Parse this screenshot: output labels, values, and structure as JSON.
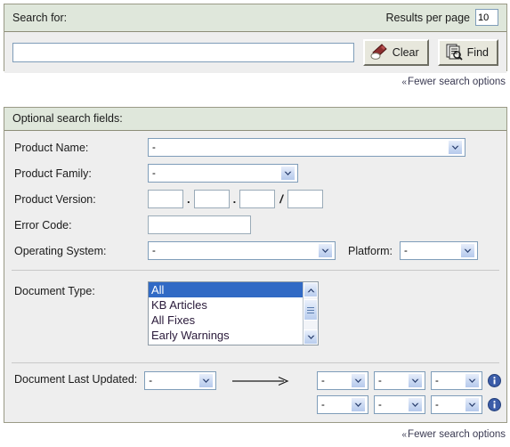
{
  "search_panel": {
    "title": "Search for:",
    "results_per_page_label": "Results per page",
    "results_per_page_value": "10",
    "query_value": "",
    "query_placeholder": "",
    "clear_button": "Clear",
    "find_button": "Find"
  },
  "fewer_link_top": {
    "chevron": "«",
    "label": "Fewer search options"
  },
  "fewer_link_bottom": {
    "chevron": "«",
    "label": "Fewer search options"
  },
  "optional_panel": {
    "title": "Optional search fields:",
    "fields": {
      "product_name": {
        "label": "Product Name:",
        "value": "-"
      },
      "product_family": {
        "label": "Product Family:",
        "value": "-"
      },
      "product_version": {
        "label": "Product Version:",
        "v1": "",
        "v2": "",
        "v3": "",
        "v4": "",
        "sep1": ".",
        "sep2": ".",
        "sep3": "/"
      },
      "error_code": {
        "label": "Error Code:",
        "value": ""
      },
      "operating_system": {
        "label": "Operating System:",
        "value": "-"
      },
      "platform": {
        "label": "Platform:",
        "value": "-"
      },
      "document_type": {
        "label": "Document Type:",
        "options": [
          "All",
          "KB Articles",
          "All Fixes",
          "Early Warnings"
        ],
        "selected": "All"
      },
      "document_last_updated": {
        "label": "Document Last Updated:",
        "from_value": "-",
        "arrow": "→",
        "row1": [
          "-",
          "-",
          "-"
        ],
        "row2": [
          "-",
          "-",
          "-"
        ],
        "info_tooltip": "i"
      }
    }
  },
  "colors": {
    "header_green": "#dfe7db",
    "panel_body": "#eeeeee",
    "panel_border": "#9a9a86",
    "select_border": "#7f9db9",
    "selection_blue": "#316ac5",
    "info_blue": "#3b5ca8",
    "link_text": "#3a3a52"
  }
}
